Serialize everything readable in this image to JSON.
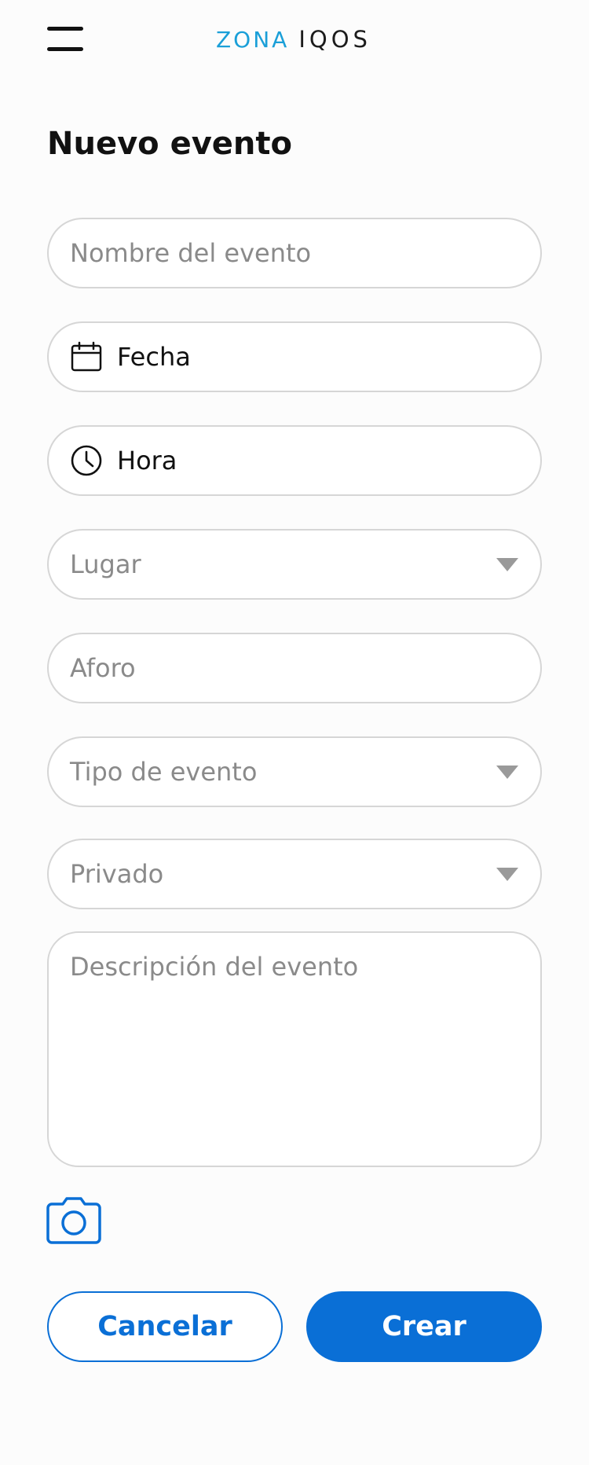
{
  "header": {
    "logo_zona": "ZONA",
    "logo_iqos": "IQOS"
  },
  "page": {
    "title": "Nuevo evento"
  },
  "form": {
    "name_placeholder": "Nombre del evento",
    "date_value": "Fecha",
    "time_value": "Hora",
    "place_placeholder": "Lugar",
    "capacity_placeholder": "Aforo",
    "event_type_placeholder": "Tipo de evento",
    "privacy_placeholder": "Privado",
    "description_placeholder": "Descripción del evento"
  },
  "actions": {
    "cancel_label": "Cancelar",
    "create_label": "Crear"
  },
  "colors": {
    "primary": "#0a6fd6",
    "logo_accent": "#1a9fd8",
    "border": "#d6d6d6",
    "placeholder": "#8a8a8a"
  },
  "icons": [
    "menu-icon",
    "calendar-icon",
    "clock-icon",
    "chevron-down-icon",
    "camera-icon"
  ]
}
